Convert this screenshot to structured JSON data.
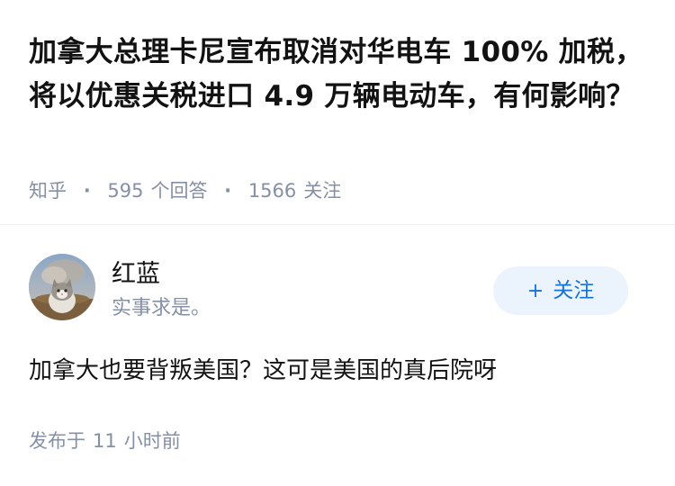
{
  "question": {
    "title": "加拿大总理卡尼宣布取消对华电车 100% 加税，将以优惠关税进口 4.9 万辆电动车，有何影响？",
    "source": "知乎",
    "answer_count": "595",
    "answer_label": "个回答",
    "follow_count": "1566",
    "follow_label": "关注"
  },
  "author": {
    "name": "红蓝",
    "bio": "实事求是。",
    "avatar_icon": "cat-avatar-icon",
    "follow_button": {
      "plus": "+",
      "label": "关注"
    }
  },
  "answer": {
    "text": "加拿大也要背叛美国？这可是美国的真后院呀",
    "published_prefix": "发布于",
    "published_value": "11",
    "published_suffix": "小时前"
  },
  "colors": {
    "accent": "#1772d8",
    "accent_bg": "#ebf3fc",
    "meta_gray": "#8590a6",
    "text_main": "#121212"
  }
}
